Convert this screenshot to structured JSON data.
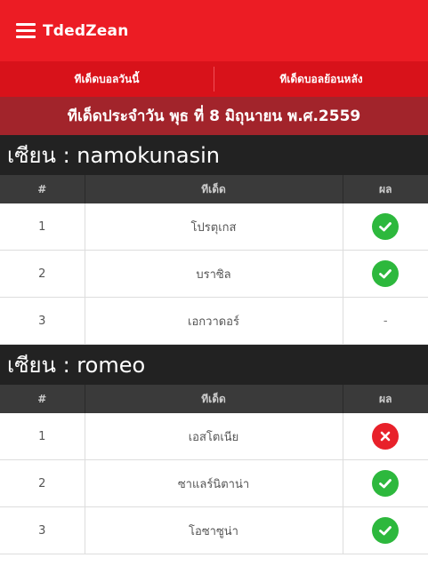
{
  "header": {
    "brand": "TdedZean"
  },
  "nav": {
    "tab_today": "ทีเด็ดบอลวันนี้",
    "tab_history": "ทีเด็ดบอลย้อนหลัง"
  },
  "date_title": "ทีเด็ดประจำวัน พุธ ที่ 8 มิถุนายน พ.ศ.2559",
  "columns": {
    "num": "#",
    "tip": "ทีเด็ด",
    "result": "ผล"
  },
  "sections": [
    {
      "title": "เซียน : namokunasin",
      "rows": [
        {
          "num": "1",
          "tip": "โปรตุเกส",
          "result": "win"
        },
        {
          "num": "2",
          "tip": "บราซิล",
          "result": "win"
        },
        {
          "num": "3",
          "tip": "เอกวาดอร์",
          "result": "-"
        }
      ]
    },
    {
      "title": "เซียน : romeo",
      "rows": [
        {
          "num": "1",
          "tip": "เอสโตเนีย",
          "result": "lose"
        },
        {
          "num": "2",
          "tip": "ซาแลร์นิตาน่า",
          "result": "win"
        },
        {
          "num": "3",
          "tip": "โอซาซูน่า",
          "result": "win"
        }
      ]
    }
  ],
  "colors": {
    "primary_red": "#ec1c24",
    "dark_red": "#a2242b",
    "win_green": "#2db83d",
    "lose_red": "#e8212a"
  }
}
